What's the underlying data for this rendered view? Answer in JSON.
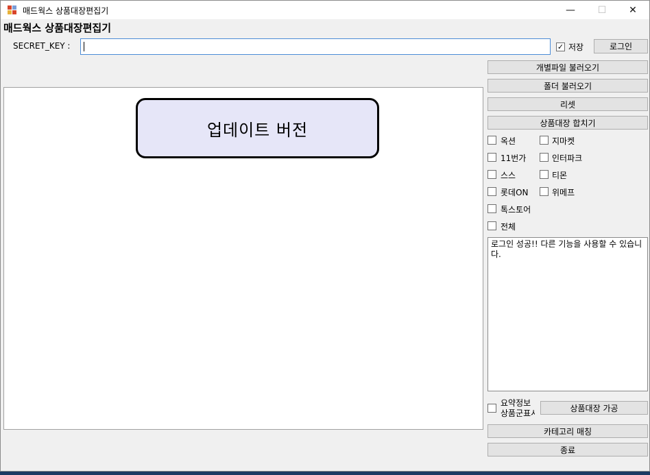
{
  "window": {
    "title": "매드웍스 상품대장편집기",
    "minimize_glyph": "—",
    "maximize_glyph": "☐",
    "close_glyph": "✕"
  },
  "heading": "매드웍스 상품대장편집기",
  "login": {
    "key_label": "SECRET_KEY :",
    "key_value": "",
    "save_label": "저장",
    "save_checked": "✓",
    "login_button": "로그인"
  },
  "actions": {
    "load_file": "개별파일 불러오기",
    "load_folder": "폴더 불러오기",
    "reset": "리셋",
    "merge": "상품대장 합치기"
  },
  "markets": [
    {
      "label": "옥션"
    },
    {
      "label": "지마켓"
    },
    {
      "label": "11번가"
    },
    {
      "label": "인터파크"
    },
    {
      "label": "스스"
    },
    {
      "label": "티몬"
    },
    {
      "label": "롯데ON"
    },
    {
      "label": "위메프"
    },
    {
      "label": "톡스토어"
    },
    {
      "label": "전체"
    }
  ],
  "update_banner": "업데이트 버전",
  "log_text": "로그인 성공!! 다른 기능을 사용할 수 있습니다.",
  "summary": {
    "line1": "요약정보",
    "line2": "상품군표시",
    "process_button": "상품대장 가공"
  },
  "category_button": "카테고리 매칭",
  "exit_button": "종료",
  "colors": {
    "banner_fill": "#e6e6f8",
    "input_focus_border": "#4a8bd6",
    "window_bg": "#f0f0f0"
  }
}
